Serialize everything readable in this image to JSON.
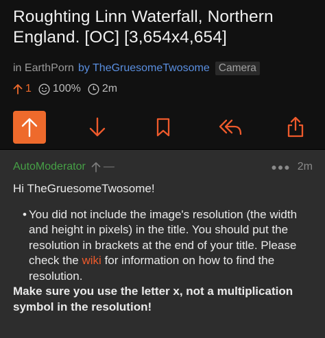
{
  "post": {
    "title": "Roughting Linn Waterfall, Northern England. [OC] [3,654x4,654]",
    "subreddit_prefix": "in ",
    "subreddit": "EarthPorn",
    "by_label": "by",
    "author": "TheGruesomeTwosome",
    "flair": "Camera",
    "score": "1",
    "upvote_ratio": "100%",
    "age": "2m",
    "accent_color": "#ee6a2c"
  },
  "comment": {
    "author": "AutoModerator",
    "score": "—",
    "age": "2m",
    "greeting": "Hi TheGruesomeTwosome!",
    "bullet_part1": "You did not include the image's resolution (the width and height in pixels) in the title. You should put the resolution in brackets at the end of your title. Please check the ",
    "bullet_link": "wiki",
    "bullet_part2": " for information on how to find the resolution.",
    "bold_note": "Make sure you use the letter x, not a multiplication symbol in the resolution!"
  }
}
